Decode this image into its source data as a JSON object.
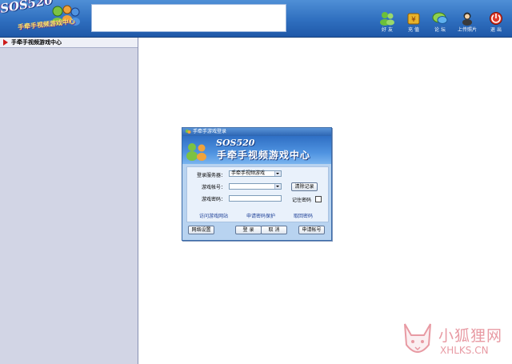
{
  "app": {
    "logo_text": "SOS520",
    "logo_subtitle": "手牵手视频游戏中心"
  },
  "toolbar": [
    {
      "label": "好 友",
      "icon": "friends-icon"
    },
    {
      "label": "充 值",
      "icon": "recharge-icon"
    },
    {
      "label": "论 坛",
      "icon": "forum-icon"
    },
    {
      "label": "上传照片",
      "icon": "upload-photo-icon"
    },
    {
      "label": "退 出",
      "icon": "exit-icon"
    }
  ],
  "sidebar": {
    "header": "手牵手视频游戏中心"
  },
  "dialog": {
    "title": "手牵手游戏登录",
    "banner_logo": "SOS520",
    "banner_title": "手牵手视频游戏中心",
    "server_label": "登录服务器：",
    "server_value": "手牵手视频游戏",
    "account_label": "游戏帐号：",
    "account_value": "",
    "password_label": "游戏密码：",
    "password_value": "",
    "clear_button": "清除记录",
    "remember_label": "记住密码",
    "remember_checked": false,
    "link_visit": "访问游戏网站",
    "link_protect": "申请密码保护",
    "link_recover": "取回密码",
    "btn_network": "网络设置",
    "btn_login": "登 录",
    "btn_cancel": "取 消",
    "btn_register": "申请帐号"
  },
  "watermark": {
    "cn": "小狐狸网",
    "url": "XHLKS.CN"
  },
  "colors": {
    "topbar": "#2f6fbf",
    "sidebar": "#d2d5e5",
    "dialog_bg": "#b8d3f0",
    "link": "#1b3e96",
    "watermark": "#e89aa3"
  }
}
